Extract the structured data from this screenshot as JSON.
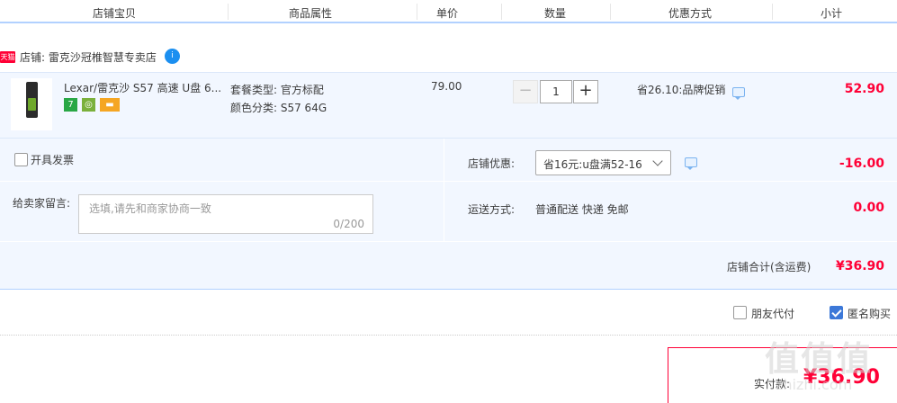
{
  "columns": [
    "店铺宝贝",
    "商品属性",
    "单价",
    "数量",
    "优惠方式",
    "小计"
  ],
  "shop": {
    "badge": "天猫",
    "label": "店铺: 雷克沙冠椎智慧专卖店",
    "ww": "i"
  },
  "item": {
    "title": "Lexar/雷克沙 S57 高速 U盘 6...",
    "icons": [
      {
        "text": "7",
        "color": "#29a745"
      },
      {
        "text": "◎",
        "color": "#7ab03b"
      },
      {
        "text": "▬",
        "color": "#f5a623"
      }
    ],
    "prop1": "套餐类型: 官方标配",
    "prop2": "颜色分类: S57 64G",
    "unit_price": "79.00",
    "minus": "−",
    "quantity": "1",
    "plus": "+",
    "promo": "省26.10:品牌促销",
    "subtotal": "52.90"
  },
  "invoice": {
    "label": "开具发票"
  },
  "shop_discount": {
    "label": "店铺优惠:",
    "selected": "省16元:u盘满52-16",
    "amount": "-16.00"
  },
  "message": {
    "label": "给卖家留言:",
    "placeholder": "选填,请先和商家协商一致",
    "count": "0/200"
  },
  "shipping": {
    "label": "运送方式:",
    "value": "普通配送 快递 免邮",
    "amount": "0.00"
  },
  "shop_total": {
    "label": "店铺合计(含运费)",
    "amount": "¥36.90"
  },
  "options": {
    "friend_pay": "朋友代付",
    "anonymous": "匿名购买"
  },
  "payment": {
    "label": "实付款:",
    "amount": "¥36.90"
  },
  "watermark": {
    "main": "值值值",
    "sub": "zhizhi.com"
  },
  "colors": {
    "accent_red": "#ff0036",
    "header_line": "#b2d1ff",
    "panel_bg": "#f2f7ff"
  }
}
